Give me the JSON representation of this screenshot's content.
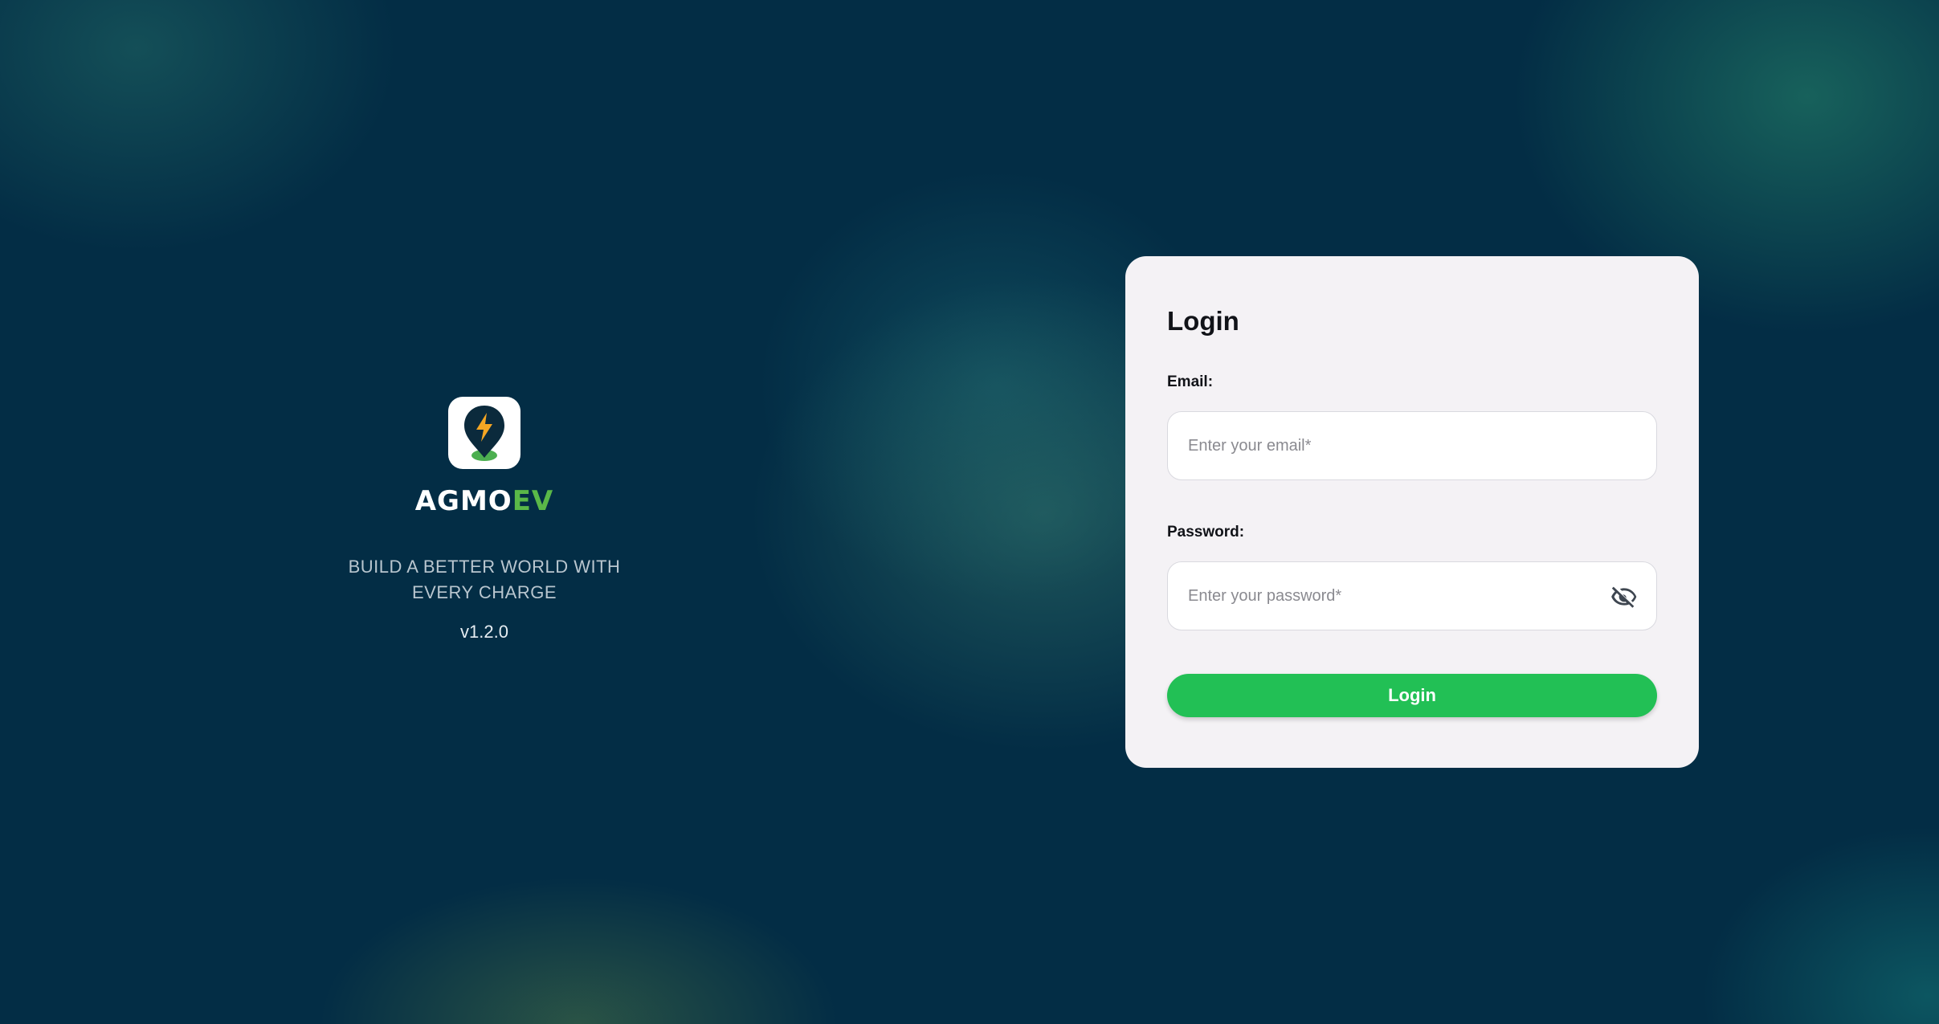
{
  "brand": {
    "icon": "charging-pin-icon",
    "name_part1": "AGMO",
    "name_part2": "EV",
    "tagline": "BUILD A BETTER WORLD WITH EVERY CHARGE",
    "version": "v1.2.0"
  },
  "login": {
    "title": "Login",
    "email_label": "Email:",
    "email_placeholder": "Enter your email*",
    "email_value": "",
    "password_label": "Password:",
    "password_placeholder": "Enter your password*",
    "password_value": "",
    "password_toggle_icon": "eye-off-icon",
    "submit_label": "Login"
  },
  "colors": {
    "background": "#032d45",
    "card": "#f4f2f5",
    "accent_green": "#22c055",
    "brand_green": "#5ab848",
    "bolt_orange": "#f5a623"
  }
}
